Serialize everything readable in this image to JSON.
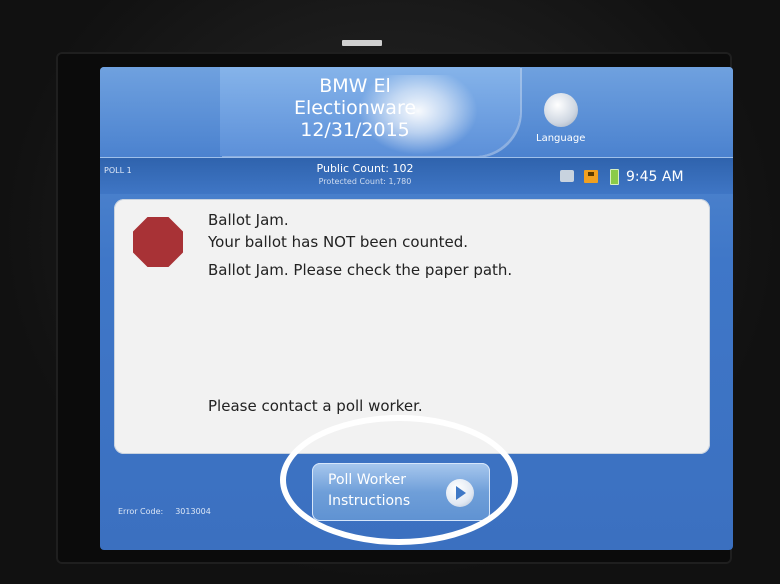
{
  "header": {
    "title_line1": "BMW El",
    "title_line2": "Electionware",
    "title_line3": "12/31/2015",
    "language_label": "Language"
  },
  "status_bar": {
    "poll_label": "POLL 1",
    "public_count": "Public Count: 102",
    "protected_count": "Protected Count: 1,780",
    "time": "9:45 AM"
  },
  "message": {
    "line1": "Ballot Jam.",
    "line2": "Your ballot has NOT been counted.",
    "line3": "Ballot Jam.  Please check the paper path.",
    "line4": "Please contact a poll worker."
  },
  "poll_worker_button": {
    "line1": "Poll Worker",
    "line2": "Instructions"
  },
  "error": {
    "label": "Error Code:",
    "code": "3013004"
  },
  "icons": [
    "stop-icon",
    "language-icon",
    "printer-icon",
    "save-icon",
    "battery-icon",
    "arrow-right-icon"
  ],
  "colors": {
    "screen_blue": "#3f77c8",
    "stop_red": "#a83236",
    "panel_bg": "#f2f2f2",
    "circle_highlight": "#ffffff"
  }
}
